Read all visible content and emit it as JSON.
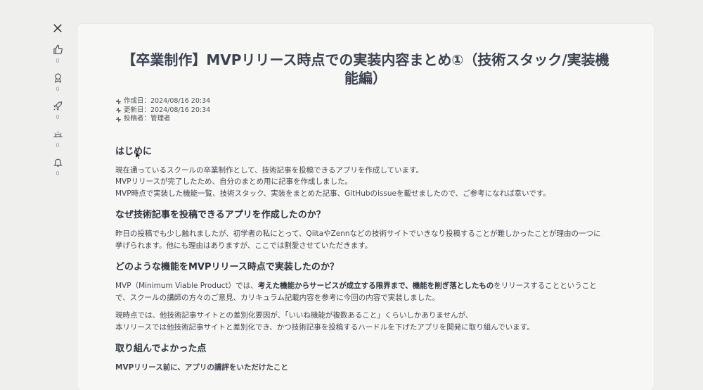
{
  "sidebar": {
    "x_label": "𝕏",
    "items": [
      {
        "icon": "thumbs-up-icon",
        "count": "0"
      },
      {
        "icon": "award-icon",
        "count": "0"
      },
      {
        "icon": "rocket-icon",
        "count": "0"
      },
      {
        "icon": "sunrise-icon",
        "count": "0"
      },
      {
        "icon": "bell-icon",
        "count": "0"
      }
    ]
  },
  "article": {
    "title_line1": "【卒業制作】MVPリリース時点での実装内容まとめ①（技術スタック/実装機",
    "title_line2": "能編）",
    "meta": {
      "created": "作成日：2024/08/16 20:34",
      "updated": "更新日：2024/08/16 20:34",
      "author": "投稿者：管理者"
    },
    "sections": {
      "intro_heading": "はじめに",
      "intro_p1": "現在通っているスクールの卒業制作として、技術記事を投稿できるアプリを作成しています。",
      "intro_p2": "MVPリリースが完了したため、自分のまとめ用に記事を作成しました。",
      "intro_p3": "MVP時点で実装した機能一覧、技術スタック、実装をまとめた記事、GitHubのissueを載せましたので、ご参考になれば幸いです。",
      "why_heading": "なぜ技術記事を投稿できるアプリを作成したのか？",
      "why_p1": "昨日の投稿でも少し触れましたが、初学者の私にとって、QiitaやZennなどの技術サイトでいきなり投稿することが難しかったことが理由の一つに",
      "why_p2": "挙げられます。他にも理由はありますが、ここでは割愛させていただきます。",
      "what_heading": "どのような機能をMVPリリース時点で実装したのか？",
      "what_p1_a": "MVP（Minimum Viable Product）では、",
      "what_p1_bold": "考えた機能からサービスが成立する限界まで、機能を削ぎ落としたもの",
      "what_p1_b": "をリリースすることということ",
      "what_p2": "で、スクールの講師の方々のご意見、カリキュラム記載内容を参考に今回の内容で実装しました。",
      "what_p3": "現時点では、他技術記事サイトとの差別化要因が、「いいね機能が複数あること」くらいしかありませんが、",
      "what_p4": "本リリースでは他技術記事サイトと差別化でき、かつ技術記事を投稿するハードルを下げたアプリを開発に取り組んでいます。",
      "good_heading": "取り組んでよかった点",
      "good_sub": "MVPリリース前に、アプリの講評をいただけたこと"
    }
  }
}
